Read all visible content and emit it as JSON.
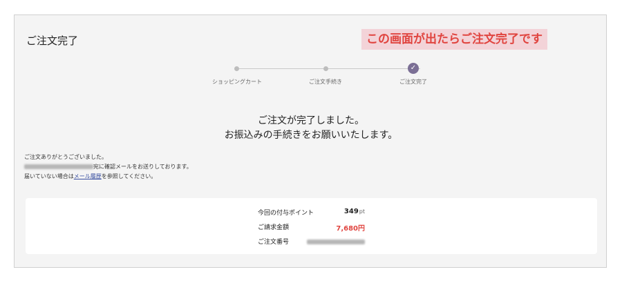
{
  "page": {
    "title": "ご注文完了",
    "callout": "この画面が出たらご注文完了です"
  },
  "stepper": {
    "steps": [
      {
        "label": "ショッピングカート",
        "state": "done"
      },
      {
        "label": "ご注文手続き",
        "state": "done"
      },
      {
        "label": "ご注文完了",
        "state": "current"
      }
    ],
    "current_step": 3
  },
  "message": {
    "line1": "ご注文が完了しました。",
    "line2": "お振込みの手続きをお願いいたします。"
  },
  "notes": {
    "thanks": "ご注文ありがとうございました。",
    "email_sent_suffix": "宛に確認メールをお送りしております。",
    "not_received_prefix": "届いていない場合は",
    "mail_history_link": "メール履歴",
    "not_received_suffix": "を参照してください。"
  },
  "summary": {
    "points_label": "今回の付与ポイント",
    "points_value": "349",
    "points_unit": "pt",
    "amount_label": "ご請求金額",
    "amount_value": "7,680円",
    "order_no_label": "ご注文番号"
  },
  "colors": {
    "accent": "#7b6f95",
    "callout_bg": "#f3d3d8",
    "callout_text": "#e0443f",
    "price": "#e0443f"
  }
}
